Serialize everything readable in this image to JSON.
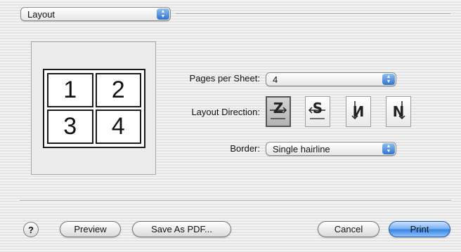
{
  "panel_menu": {
    "value": "Layout"
  },
  "preview": {
    "pages": [
      "1",
      "2",
      "3",
      "4"
    ]
  },
  "pages_per_sheet": {
    "label": "Pages per Sheet:",
    "value": "4"
  },
  "layout_direction": {
    "label": "Layout Direction:",
    "options": [
      {
        "glyph": "Z",
        "icon": "z-left-to-right-icon",
        "selected": true
      },
      {
        "glyph": "S",
        "icon": "s-right-to-left-icon",
        "selected": false
      },
      {
        "glyph": "N",
        "icon": "n-top-down-mirrored-icon",
        "selected": false
      },
      {
        "glyph": "N",
        "icon": "n-top-down-icon",
        "selected": false
      }
    ]
  },
  "border": {
    "label": "Border:",
    "value": "Single hairline"
  },
  "footer": {
    "help_label": "?",
    "preview_label": "Preview",
    "save_pdf_label": "Save As PDF...",
    "cancel_label": "Cancel",
    "print_label": "Print"
  },
  "colors": {
    "accent": "#3a86e3",
    "selected_direction": "#b3b3b3"
  }
}
